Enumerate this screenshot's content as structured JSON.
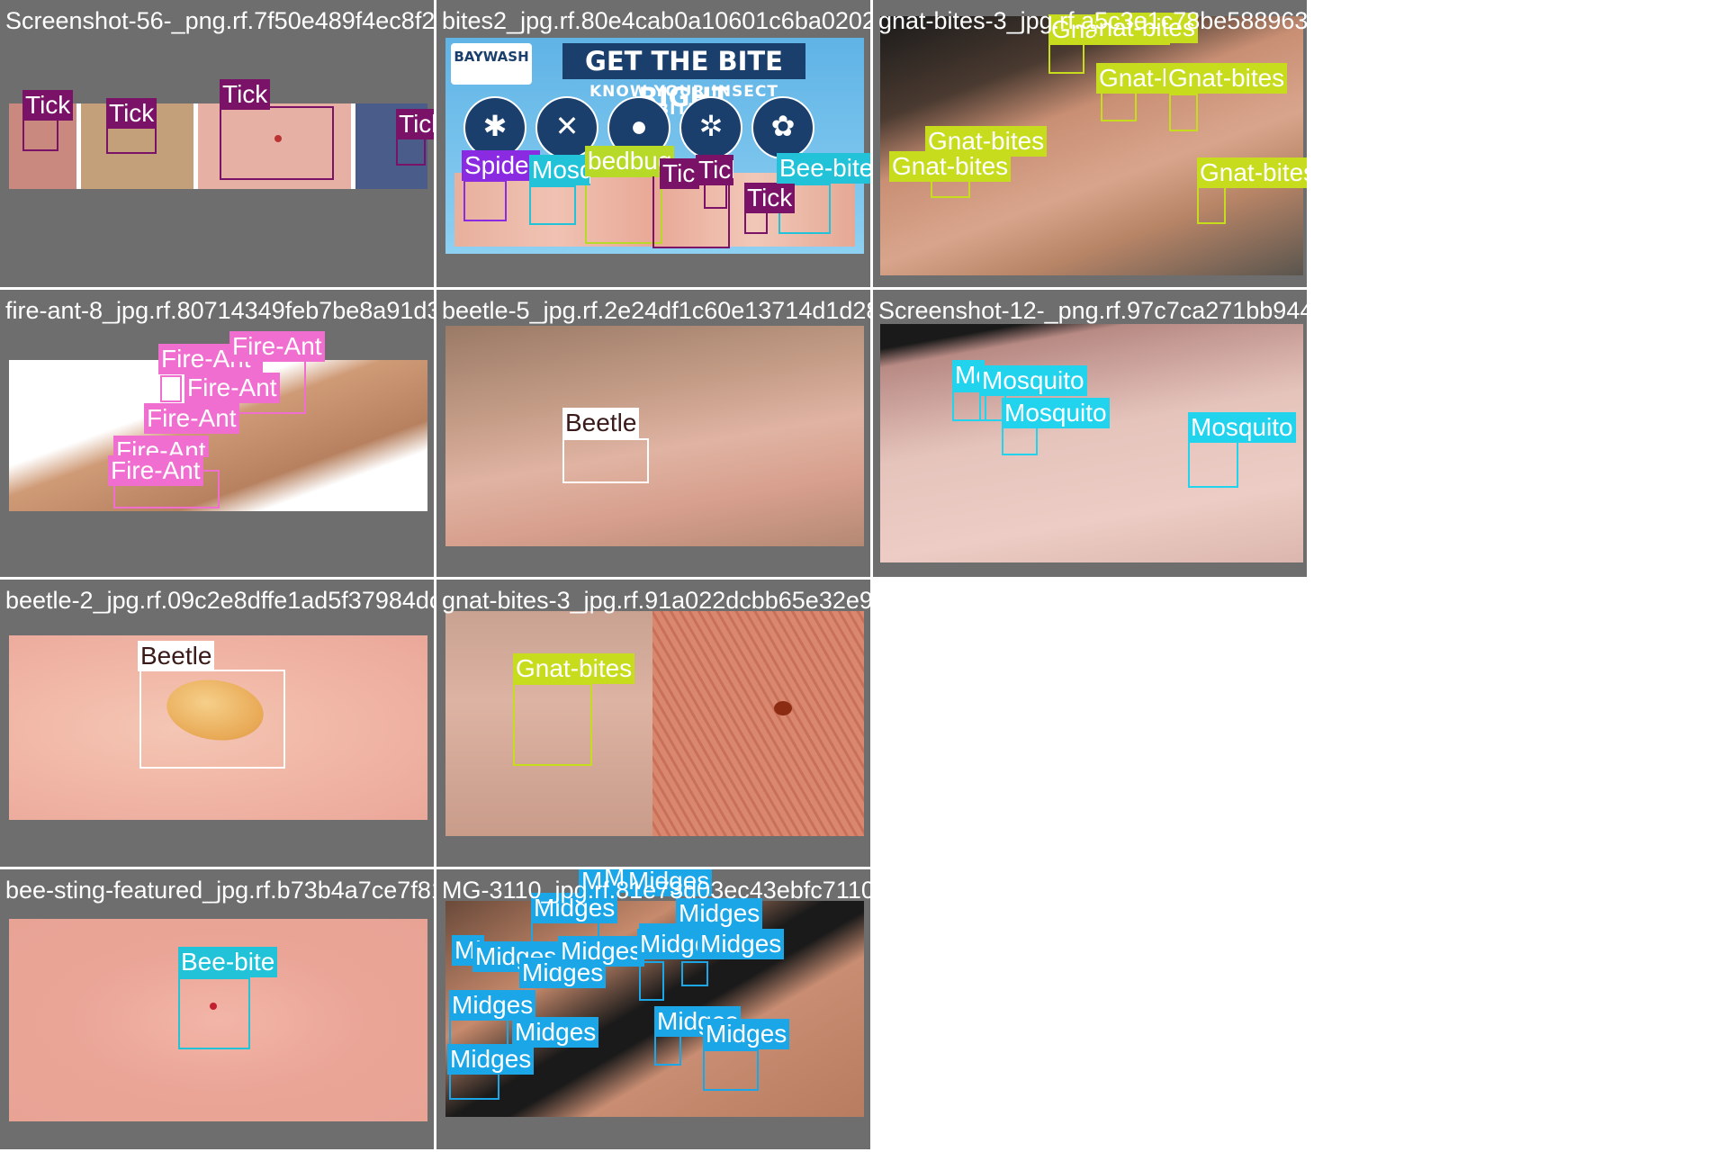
{
  "tiles": [
    {
      "filename": "Screenshot-56-_png.rf.7f50e489f4ec8f2543",
      "labels": [
        "Tick",
        "Tick",
        "Tick",
        "Tick"
      ],
      "color": "#7a1268"
    },
    {
      "filename": "bites2_jpg.rf.80e4cab0a10601c6ba020229226",
      "banner": {
        "logo": "BAYWASH",
        "title": "GET THE BITE RIGHT",
        "subtitle": "KNOW YOUR INSECT BITES"
      },
      "labels": [
        "Spider",
        "Mosquito",
        "bedbug",
        "Tick",
        "Tick",
        "Tick",
        "Bee-bite"
      ],
      "colors": {
        "Spider": "#8a2be2",
        "Mosquito": "#22c3d8",
        "bedbug": "#b7d928",
        "Tick": "#7a1268",
        "Bee-bite": "#22c3d8"
      }
    },
    {
      "filename": "gnat-bites-3_jpg.rf.a5c3e1c78be588963e95b4",
      "labels": [
        "Gnat-bites",
        "Gnat-bites",
        "Gnat-bites",
        "Gnat-bites",
        "Gnat-bites",
        "Gnat-bites",
        "Gnat-bites"
      ],
      "color": "#c8dc1e"
    },
    {
      "filename": "fire-ant-8_jpg.rf.80714349feb7be8a91d305",
      "labels": [
        "Fire-Ant",
        "Fire-Ant",
        "Fire-Ant",
        "Fire-Ant",
        "Fire-Ant",
        "Fire-Ant"
      ],
      "color": "#f06ed0"
    },
    {
      "filename": "beetle-5_jpg.rf.2e24df1c60e13714d1d285b6b7",
      "labels": [
        "Beetle"
      ],
      "color": "#ffffff"
    },
    {
      "filename": "Screenshot-12-_png.rf.97c7ca271bb944dcdb",
      "labels": [
        "Mosquito",
        "Mosquito",
        "Mosquito",
        "Mosquito"
      ],
      "color": "#22d3ee"
    },
    {
      "filename": "beetle-2_jpg.rf.09c2e8dffe1ad5f37984dc73",
      "labels": [
        "Beetle"
      ],
      "color": "#ffffff"
    },
    {
      "filename": "gnat-bites-3_jpg.rf.91a022dcbb65e32e94995",
      "labels": [
        "Gnat-bites"
      ],
      "color": "#c8dc1e"
    },
    {
      "filename": "bee-sting-featured_jpg.rf.b73b4a7ce7f810",
      "labels": [
        "Bee-bite"
      ],
      "color": "#22c3d8"
    },
    {
      "filename": "MG-3110_jpg.rf.81e73d03ec43ebfc7110a9db379",
      "labels": [
        "Midges",
        "Midges",
        "Midges",
        "Midges",
        "Midges",
        "Midges",
        "Midges",
        "Midges",
        "Midges",
        "Midges",
        "Midges",
        "Midges",
        "Midges",
        "Midges",
        "Midges",
        "Midges",
        "Midges"
      ],
      "color": "#1ba6e8"
    }
  ]
}
